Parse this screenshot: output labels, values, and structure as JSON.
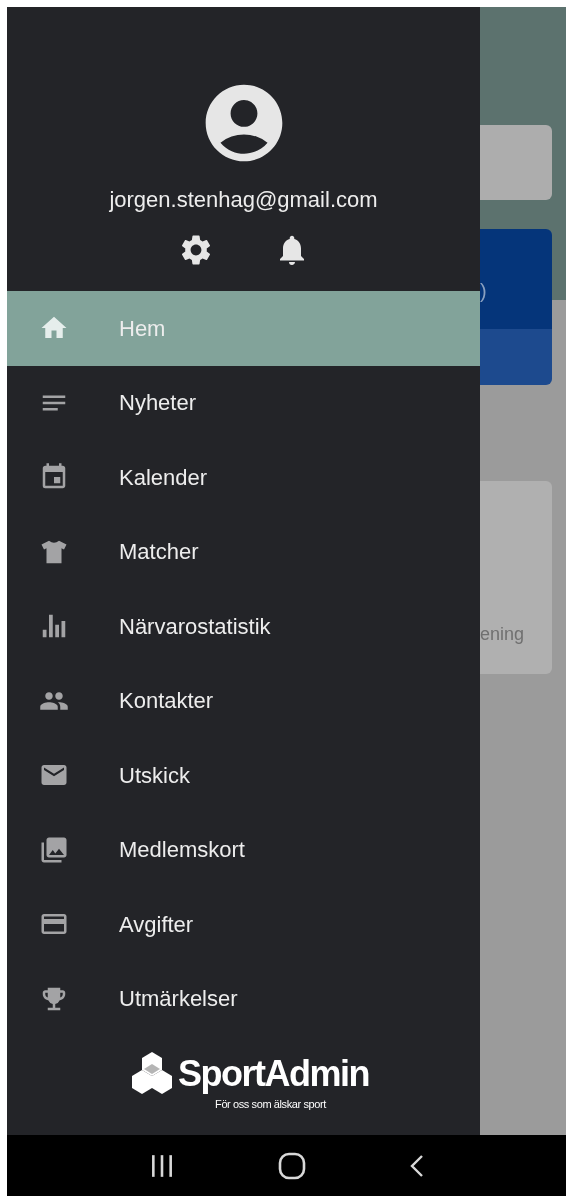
{
  "account": {
    "email": "jorgen.stenhag@gmail.com"
  },
  "menu": [
    {
      "label": "Hem",
      "kind": "home",
      "selected": true
    },
    {
      "label": "Nyheter",
      "kind": "news",
      "selected": false
    },
    {
      "label": "Kalender",
      "kind": "calendar",
      "selected": false
    },
    {
      "label": "Matcher",
      "kind": "shirt",
      "selected": false
    },
    {
      "label": "Närvarostatistik",
      "kind": "stats",
      "selected": false
    },
    {
      "label": "Kontakter",
      "kind": "people",
      "selected": false
    },
    {
      "label": "Utskick",
      "kind": "mail",
      "selected": false
    },
    {
      "label": "Medlemskort",
      "kind": "images",
      "selected": false
    },
    {
      "label": "Avgifter",
      "kind": "card",
      "selected": false
    },
    {
      "label": "Utmärkelser",
      "kind": "trophy",
      "selected": false
    }
  ],
  "brand": {
    "name": "SportAdmin",
    "tagline": "För oss som älskar sport"
  },
  "background": {
    "card_texts": [
      ")",
      "ening"
    ]
  }
}
